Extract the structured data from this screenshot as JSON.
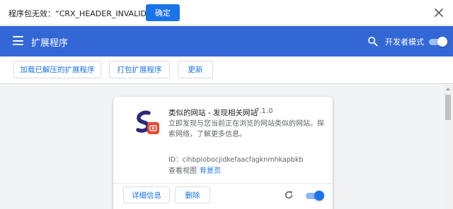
{
  "error_bar": {
    "message": "程序包无效：“CRX_HEADER_INVALID”。",
    "ok_label": "确定"
  },
  "header": {
    "title": "扩展程序",
    "dev_mode_label": "开发者模式",
    "dev_mode_on": true
  },
  "toolbar": {
    "load_unpacked": "加载已解压的扩展程序",
    "pack": "打包扩展程序",
    "update": "更新"
  },
  "extension": {
    "name": "类似的网站 - 发现相关网站",
    "version": "7.1.0",
    "description": "立即发现与您当前正在浏览的网站类似的网站。探索网络，了解更多信息。",
    "id_text": "ID：cihbplobocjidkefaacfagknmhkapbkb",
    "inspect_label": "查看视图",
    "background_page_link": "背景页",
    "details_label": "详细信息",
    "remove_label": "删除",
    "enabled": true
  },
  "colors": {
    "header_bg": "#3367d6",
    "accent": "#1a73e8"
  },
  "icons": [
    "close-icon",
    "menu-icon",
    "search-icon",
    "reload-icon",
    "extension-logo-icon"
  ]
}
